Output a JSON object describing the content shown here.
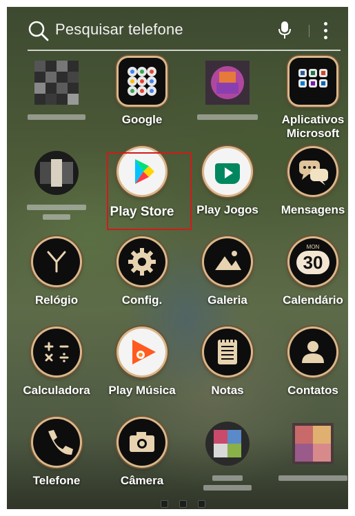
{
  "search": {
    "placeholder": "Pesquisar telefone",
    "icons": [
      "search-icon",
      "mic-icon",
      "more-vert-icon"
    ]
  },
  "apps": [
    {
      "label": "",
      "icon": "blurred-app-icon",
      "blurred": true
    },
    {
      "label": "Google",
      "icon": "google-folder-icon"
    },
    {
      "label": "",
      "icon": "blurred-app-icon",
      "blurred": true
    },
    {
      "label": "Aplicativos Microsoft",
      "icon": "microsoft-folder-icon"
    },
    {
      "label": "",
      "icon": "blurred-app-icon",
      "blurred": true
    },
    {
      "label": "Play Store",
      "icon": "play-store-icon",
      "highlighted": true
    },
    {
      "label": "Play Jogos",
      "icon": "play-games-icon"
    },
    {
      "label": "Mensagens",
      "icon": "messages-icon"
    },
    {
      "label": "Relógio",
      "icon": "clock-icon"
    },
    {
      "label": "Config.",
      "icon": "settings-gear-icon"
    },
    {
      "label": "Galeria",
      "icon": "gallery-icon"
    },
    {
      "label": "Calendário",
      "icon": "calendar-icon",
      "calendar_month": "MON",
      "calendar_day": "30"
    },
    {
      "label": "Calculadora",
      "icon": "calculator-icon"
    },
    {
      "label": "Play Música",
      "icon": "play-music-icon"
    },
    {
      "label": "Notas",
      "icon": "notes-icon"
    },
    {
      "label": "Contatos",
      "icon": "contacts-icon"
    },
    {
      "label": "Telefone",
      "icon": "phone-icon"
    },
    {
      "label": "Câmera",
      "icon": "camera-icon"
    },
    {
      "label": "",
      "icon": "blurred-app-icon",
      "blurred": true
    },
    {
      "label": "",
      "icon": "blurred-app-icon",
      "blurred": true
    }
  ],
  "page_indicator": {
    "pages": 3,
    "current": 1
  },
  "colors": {
    "highlight": "#d11a1a",
    "ring": "#d9b78a"
  }
}
